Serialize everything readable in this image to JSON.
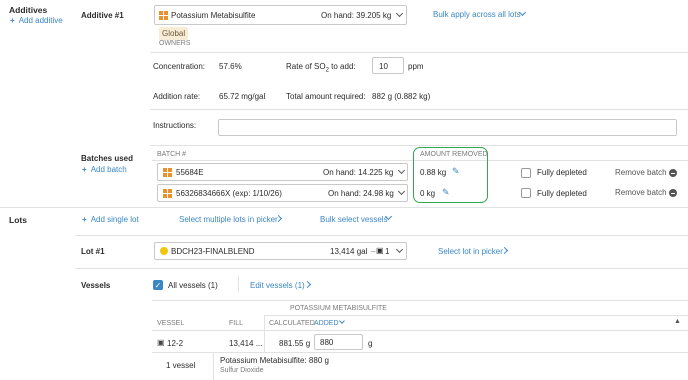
{
  "additives": {
    "section_label": "Additives",
    "add_link": "Add additive",
    "item_label": "Additive #1",
    "select": {
      "name": "Potassium Metabisulfite",
      "on_hand": "On hand:  39.205 kg"
    },
    "bulk_apply": "Bulk apply across all lots",
    "badge": "Global",
    "owners": "OWNERS",
    "concentration_label": "Concentration:",
    "concentration_value": "57.6%",
    "rate_label": "Rate of SO",
    "rate_sub": "2",
    "rate_label_end": " to add:",
    "rate_value": "10",
    "rate_unit": "ppm",
    "addition_rate_label": "Addition rate:",
    "addition_rate_value": "65.72 mg/gal",
    "total_label": "Total amount required:",
    "total_value": "882 g (0.882 kg)",
    "instructions_label": "Instructions:",
    "instructions_value": ""
  },
  "batches": {
    "label": "Batches used",
    "add_link": "Add batch",
    "col_batch": "BATCH #",
    "col_amount": "AMOUNT REMOVED",
    "rows": [
      {
        "batch": "55684E",
        "on_hand": "On hand:  14.225 kg",
        "amount": "0.88  kg",
        "depleted": "Fully depleted",
        "remove": "Remove batch"
      },
      {
        "batch": "56326834666X  (exp: 1/10/26)",
        "on_hand": "On hand:  24.98 kg",
        "amount": "0  kg",
        "depleted": "Fully depleted",
        "remove": "Remove batch"
      }
    ]
  },
  "lots": {
    "section_label": "Lots",
    "add_single": "Add single lot",
    "select_multiple": "Select multiple lots in picker",
    "bulk_select": "Bulk select vessels",
    "item_label": "Lot #1",
    "lot_name": "BDCH23-FINALBLEND",
    "lot_volume": "13,414 gal",
    "lot_count": "1",
    "select_lot_picker": "Select lot in picker"
  },
  "vessels": {
    "label": "Vessels",
    "all_vessels": "All vessels (1)",
    "edit_vessels": "Edit vessels (1)",
    "group_header": "POTASSIUM METABISULFITE",
    "col_vessel": "VESSEL",
    "col_fill": "FILL",
    "col_calculated": "CALCULATED",
    "col_added": "ADDED",
    "row": {
      "vessel": "12-2",
      "fill": "13,414 ...",
      "calculated": "881.55  g",
      "added": "880",
      "unit": "g"
    },
    "footer_count": "1 vessel",
    "footer_total": "Potassium Metabisulfite:  880 g",
    "footer_sub": "Sulfur Dioxide"
  },
  "colors": {
    "accent": "#3b86c6",
    "highlight": "#2fa84f",
    "badge_bg": "#f7ecd6"
  }
}
